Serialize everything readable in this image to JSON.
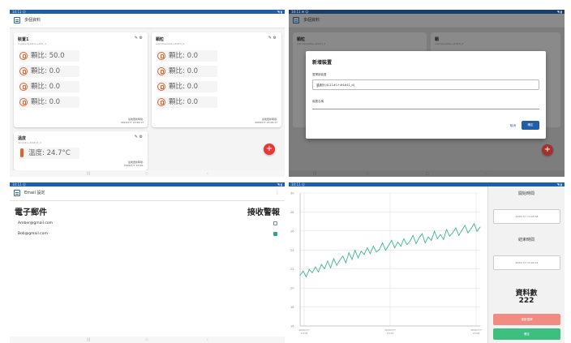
{
  "colors": {
    "primary": "#1e5fa8",
    "accent_red": "#e53935",
    "sensor_orange": "#e0622c",
    "chart_green": "#3cb88a",
    "btn_danger": "#f28b82",
    "btn_ok": "#3dbf80",
    "check_on": "#2aa88a"
  },
  "icons": [
    "menu-icon",
    "edit-icon",
    "settings-icon",
    "sensor-gauge-icon",
    "thermometer-icon",
    "add-icon",
    "chevron-down-icon",
    "more-icon"
  ],
  "screen1": {
    "title": "多個資料",
    "devices": [
      {
        "name": "裝置1",
        "id": "lingsheng2#11+4#1_d",
        "readings": [
          "顆比: 50.0",
          "顆比: 0.0",
          "顆比: 0.0",
          "顆比: 0.0"
        ],
        "updated_label": "最後更新時間:",
        "updated_value": "2020/7/7 13:09:17"
      },
      {
        "name": "顆粒",
        "id": "sda7dbaa03e+#4#4_d",
        "readings": [
          "顆比: 0.0",
          "顆比: 0.0",
          "顆比: 0.0",
          "顆比: 0.0"
        ],
        "updated_label": "最後更新時間:",
        "updated_value": "2020/7/7 13:09:17"
      },
      {
        "name": "溫度",
        "id": "4C11#1+#4#41_d",
        "readings": [
          "溫度: 24.7°C"
        ],
        "updated_label": "最後更新時間:",
        "updated_value": "2020/7/7 13:09:"
      }
    ],
    "fab": "+"
  },
  "screen2": {
    "title": "多個資料",
    "bg_cards": [
      {
        "name": "顆粒",
        "id": "sda7dbaa03e+#4#4_d"
      },
      {
        "name": "顆",
        "id": "sda7dbaa03e+#4#4_d"
      }
    ],
    "dialog": {
      "title": "新增裝置",
      "select_label": "選擇新裝置",
      "select_value": "溫度計(4C11#1+#4#41_d)",
      "name_label": "裝置名稱",
      "cancel": "取消",
      "confirm": "確定"
    },
    "fab": "+"
  },
  "screen3": {
    "title": "Email 設定",
    "col_email": "電子郵件",
    "col_alert": "接收警報",
    "emails": [
      {
        "address": "Amber@gmail.com",
        "checked": false
      },
      {
        "address": "Bob@gmail.com",
        "checked": true
      }
    ]
  },
  "screen4": {
    "start_label": "開始時間",
    "start_value": "2020/7/7 13:05:08",
    "end_label": "結束時間",
    "end_value": "2020/7/7 13:09:19",
    "count_label": "資料數",
    "count_value": "222",
    "btn_reset": "重新選擇",
    "btn_ok": "確定",
    "x_ticks": [
      "2020/7/7\n13:05",
      "2020/7/7\n13:07",
      "2020/7/7\n13:09"
    ],
    "y_ticks": [
      "30",
      "28",
      "26",
      "24",
      "22",
      "20",
      "18",
      "16"
    ]
  },
  "chart_data": {
    "type": "line",
    "x": [
      0,
      1,
      2,
      3,
      4,
      5,
      6,
      7,
      8,
      9,
      10,
      11,
      12,
      13,
      14,
      15,
      16,
      17,
      18,
      19,
      20,
      21,
      22,
      23,
      24,
      25,
      26,
      27,
      28,
      29,
      30,
      31,
      32,
      33,
      34,
      35,
      36,
      37,
      38,
      39,
      40,
      41,
      42,
      43,
      44,
      45,
      46,
      47,
      48,
      49,
      50,
      51,
      52,
      53,
      54,
      55,
      56,
      57,
      58,
      59
    ],
    "series": [
      {
        "values": [
          22.1,
          22.6,
          21.9,
          22.8,
          22.4,
          23.1,
          22.5,
          23.4,
          22.9,
          23.8,
          23.0,
          24.1,
          23.3,
          23.9,
          24.4,
          23.6,
          24.8,
          24.0,
          25.1,
          24.2,
          25.0,
          24.6,
          25.4,
          24.7,
          25.6,
          24.9,
          25.2,
          26.0,
          25.1,
          25.7,
          26.3,
          25.4,
          26.1,
          25.6,
          26.5,
          25.8,
          26.2,
          26.9,
          25.9,
          26.6,
          27.1,
          26.0,
          26.7,
          26.3,
          27.4,
          26.5,
          27.0,
          26.4,
          27.6,
          26.8,
          27.2,
          27.8,
          26.9,
          27.5,
          28.1,
          27.2,
          27.7,
          28.3,
          27.4,
          27.9
        ]
      }
    ],
    "ylim": [
      16,
      32
    ],
    "grid": true
  }
}
